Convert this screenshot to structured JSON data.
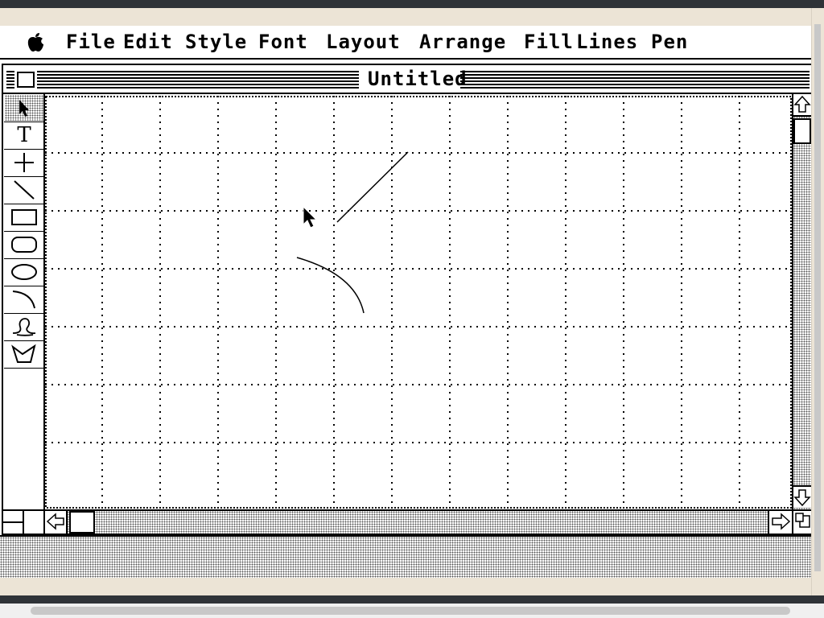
{
  "menubar": {
    "apple_icon": "apple-icon",
    "items": [
      "File",
      "Edit",
      "Style",
      "Font",
      "Layout",
      "Arrange",
      "Fill",
      "Lines",
      "Pen"
    ]
  },
  "window": {
    "title": "Untitled"
  },
  "palette": {
    "tools": [
      "pointer-tool-icon",
      "text-tool-icon",
      "crosshair-tool-icon",
      "line-tool-icon",
      "rectangle-tool-icon",
      "rounded-rectangle-tool-icon",
      "oval-tool-icon",
      "arc-tool-icon",
      "freehand-tool-icon",
      "polygon-tool-icon"
    ],
    "text_tool_glyph": "T"
  },
  "colors": {
    "frame_beige": "#ece4d6",
    "ink": "#000000",
    "paper": "#ffffff"
  }
}
